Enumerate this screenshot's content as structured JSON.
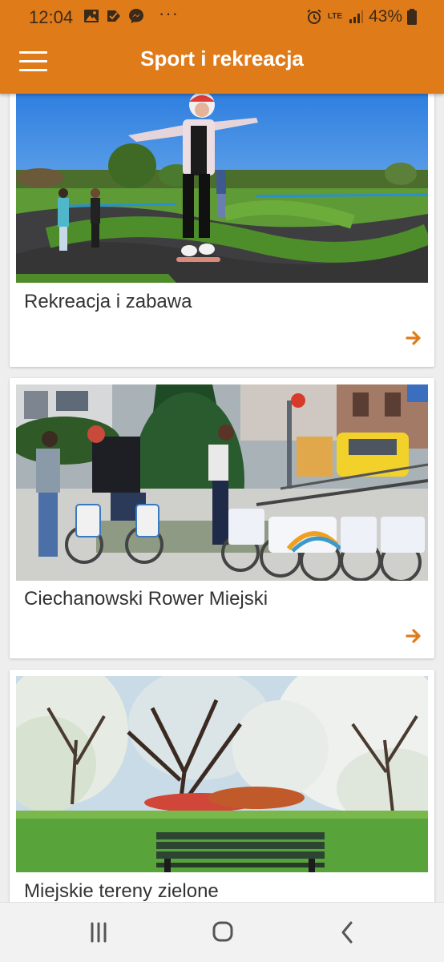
{
  "status_bar": {
    "time": "12:04",
    "more_indicator": "···",
    "network": "LTE",
    "battery": "43%",
    "notification_icons": [
      "gallery-icon",
      "check-icon",
      "messenger-icon"
    ],
    "system_icons": [
      "alarm-icon",
      "signal-icon",
      "battery-icon"
    ]
  },
  "app_bar": {
    "title": "Sport i rekreacja",
    "menu_icon": "hamburger-menu-icon",
    "color": "#e07b1a"
  },
  "cards": [
    {
      "title": "Rekreacja i zabawa",
      "image": "pumptrack-skateboard-photo",
      "arrow_icon": "arrow-right-icon"
    },
    {
      "title": "Ciechanowski Rower Miejski",
      "image": "city-bikes-photo",
      "arrow_icon": "arrow-right-icon"
    },
    {
      "title": "Miejskie tereny zielone",
      "image": "park-blossom-photo"
    }
  ],
  "accent_color": "#e07b1a",
  "nav_bar": {
    "buttons": [
      "recent-apps-icon",
      "home-icon",
      "back-icon"
    ]
  }
}
